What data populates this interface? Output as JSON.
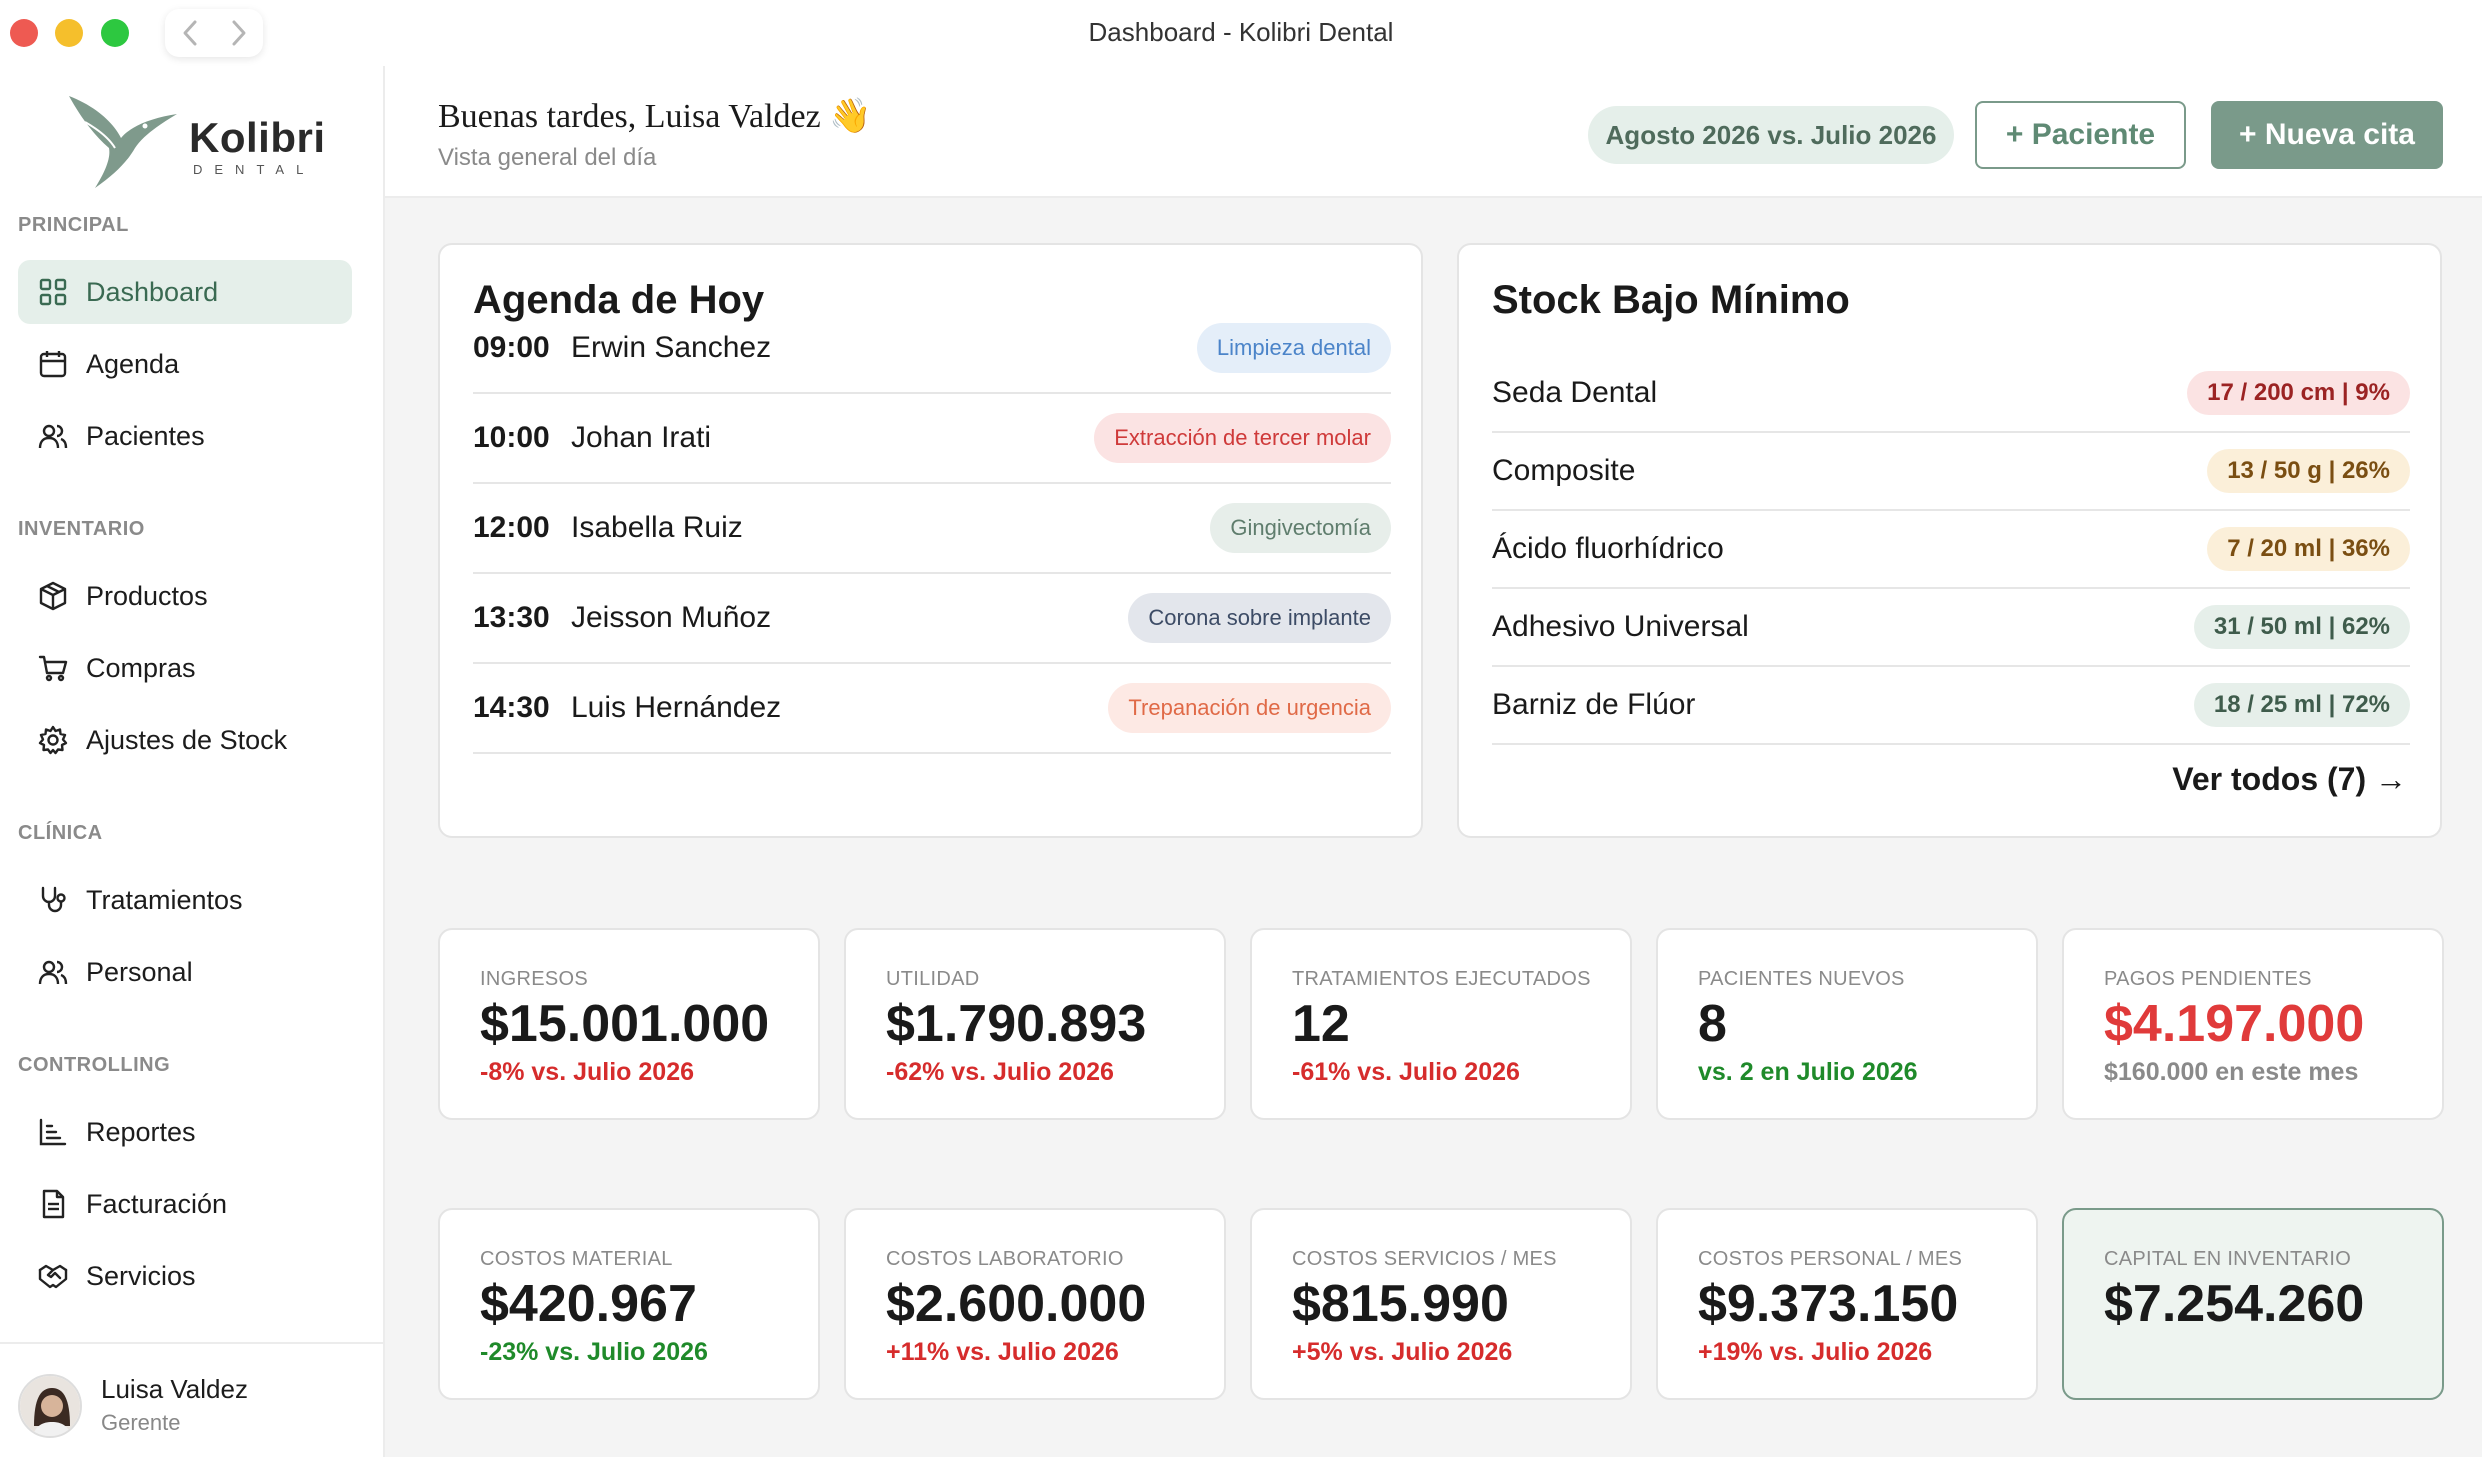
{
  "window": {
    "title": "Dashboard - Kolibri Dental"
  },
  "brand": {
    "name": "Kolibri",
    "sub": "DENTAL",
    "accent": "#7a9a8a"
  },
  "sidebar": {
    "sections": [
      {
        "label": "PRINCIPAL"
      },
      {
        "label": "INVENTARIO"
      },
      {
        "label": "CLÍNICA"
      },
      {
        "label": "CONTROLLING"
      }
    ],
    "items": [
      {
        "label": "Dashboard",
        "icon": "grid-icon",
        "active": true
      },
      {
        "label": "Agenda",
        "icon": "calendar-icon"
      },
      {
        "label": "Pacientes",
        "icon": "users-icon"
      },
      {
        "label": "Productos",
        "icon": "box-icon"
      },
      {
        "label": "Compras",
        "icon": "cart-icon"
      },
      {
        "label": "Ajustes de Stock",
        "icon": "gear-icon"
      },
      {
        "label": "Tratamientos",
        "icon": "stethoscope-icon"
      },
      {
        "label": "Personal",
        "icon": "users-icon"
      },
      {
        "label": "Reportes",
        "icon": "bar-chart-icon"
      },
      {
        "label": "Facturación",
        "icon": "document-icon"
      },
      {
        "label": "Servicios",
        "icon": "handshake-icon"
      }
    ],
    "user": {
      "name": "Luisa Valdez",
      "role": "Gerente"
    }
  },
  "header": {
    "greeting": "Buenas tardes, Luisa Valdez",
    "wave": "👋",
    "subtitle": "Vista general del día",
    "period": "Agosto 2026 vs. Julio 2026",
    "add_patient": "+ Paciente",
    "new_appointment": "+ Nueva cita"
  },
  "agenda": {
    "title": "Agenda de Hoy",
    "rows": [
      {
        "time": "09:00",
        "name": "Erwin Sanchez",
        "treatment": "Limpieza dental",
        "bg": "#e4eef9",
        "fg": "#4b84c9"
      },
      {
        "time": "10:00",
        "name": "Johan Irati",
        "treatment": "Extracción de tercer molar",
        "bg": "#fbe3e3",
        "fg": "#cf3a3a"
      },
      {
        "time": "12:00",
        "name": "Isabella Ruiz",
        "treatment": "Gingivectomía",
        "bg": "#e7eeea",
        "fg": "#5f7d6d"
      },
      {
        "time": "13:30",
        "name": "Jeisson Muñoz",
        "treatment": "Corona sobre implante",
        "bg": "#e3e6ec",
        "fg": "#3d4c66"
      },
      {
        "time": "14:30",
        "name": "Luis Hernández",
        "treatment": "Trepanación de urgencia",
        "bg": "#fde9e4",
        "fg": "#e06a47"
      }
    ]
  },
  "stock": {
    "title": "Stock Bajo Mínimo",
    "rows": [
      {
        "name": "Seda Dental",
        "level": "17 / 200 cm | 9%",
        "bg": "#fbe3e3",
        "fg": "#9b2323"
      },
      {
        "name": "Composite",
        "level": "13 / 50 g | 26%",
        "bg": "#fbefd9",
        "fg": "#7a4e12"
      },
      {
        "name": "Ácido fluorhídrico",
        "level": "7 / 20 ml | 36%",
        "bg": "#fbefd9",
        "fg": "#7a4e12"
      },
      {
        "name": "Adhesivo Universal",
        "level": "31 / 50 ml | 62%",
        "bg": "#e6efea",
        "fg": "#3f5c4c"
      },
      {
        "name": "Barniz de Flúor",
        "level": "18 / 25 ml | 72%",
        "bg": "#e6efea",
        "fg": "#3f5c4c"
      }
    ],
    "see_all": "Ver todos (7) →"
  },
  "kpis_row1": [
    {
      "label": "INGRESOS",
      "value": "$15.001.000",
      "delta": "-8% vs. Julio 2026",
      "delta_color": "#d62c2c",
      "value_color": "#1a1a1a"
    },
    {
      "label": "UTILIDAD",
      "value": "$1.790.893",
      "delta": "-62% vs. Julio 2026",
      "delta_color": "#d62c2c",
      "value_color": "#1a1a1a"
    },
    {
      "label": "TRATAMIENTOS EJECUTADOS",
      "value": "12",
      "delta": "-61% vs. Julio 2026",
      "delta_color": "#d62c2c",
      "value_color": "#1a1a1a"
    },
    {
      "label": "PACIENTES NUEVOS",
      "value": "8",
      "delta": "vs. 2 en Julio 2026",
      "delta_color": "#1f8a2a",
      "value_color": "#1a1a1a"
    },
    {
      "label": "PAGOS PENDIENTES",
      "value": "$4.197.000",
      "delta": "$160.000 en este mes",
      "delta_color": "#8a8a8a",
      "value_color": "#e03a3a"
    }
  ],
  "kpis_row2": [
    {
      "label": "COSTOS MATERIAL",
      "value": "$420.967",
      "delta": "-23% vs. Julio 2026",
      "delta_color": "#1f8a2a",
      "value_color": "#1a1a1a"
    },
    {
      "label": "COSTOS LABORATORIO",
      "value": "$2.600.000",
      "delta": "+11% vs. Julio 2026",
      "delta_color": "#d62c2c",
      "value_color": "#1a1a1a"
    },
    {
      "label": "COSTOS SERVICIOS / MES",
      "value": "$815.990",
      "delta": "+5% vs. Julio 2026",
      "delta_color": "#d62c2c",
      "value_color": "#1a1a1a"
    },
    {
      "label": "COSTOS PERSONAL / MES",
      "value": "$9.373.150",
      "delta": "+19% vs. Julio 2026",
      "delta_color": "#d62c2c",
      "value_color": "#1a1a1a"
    },
    {
      "label": "CAPITAL EN INVENTARIO",
      "value": "$7.254.260",
      "delta": "",
      "delta_color": "#1a1a1a",
      "value_color": "#1a1a1a"
    }
  ]
}
